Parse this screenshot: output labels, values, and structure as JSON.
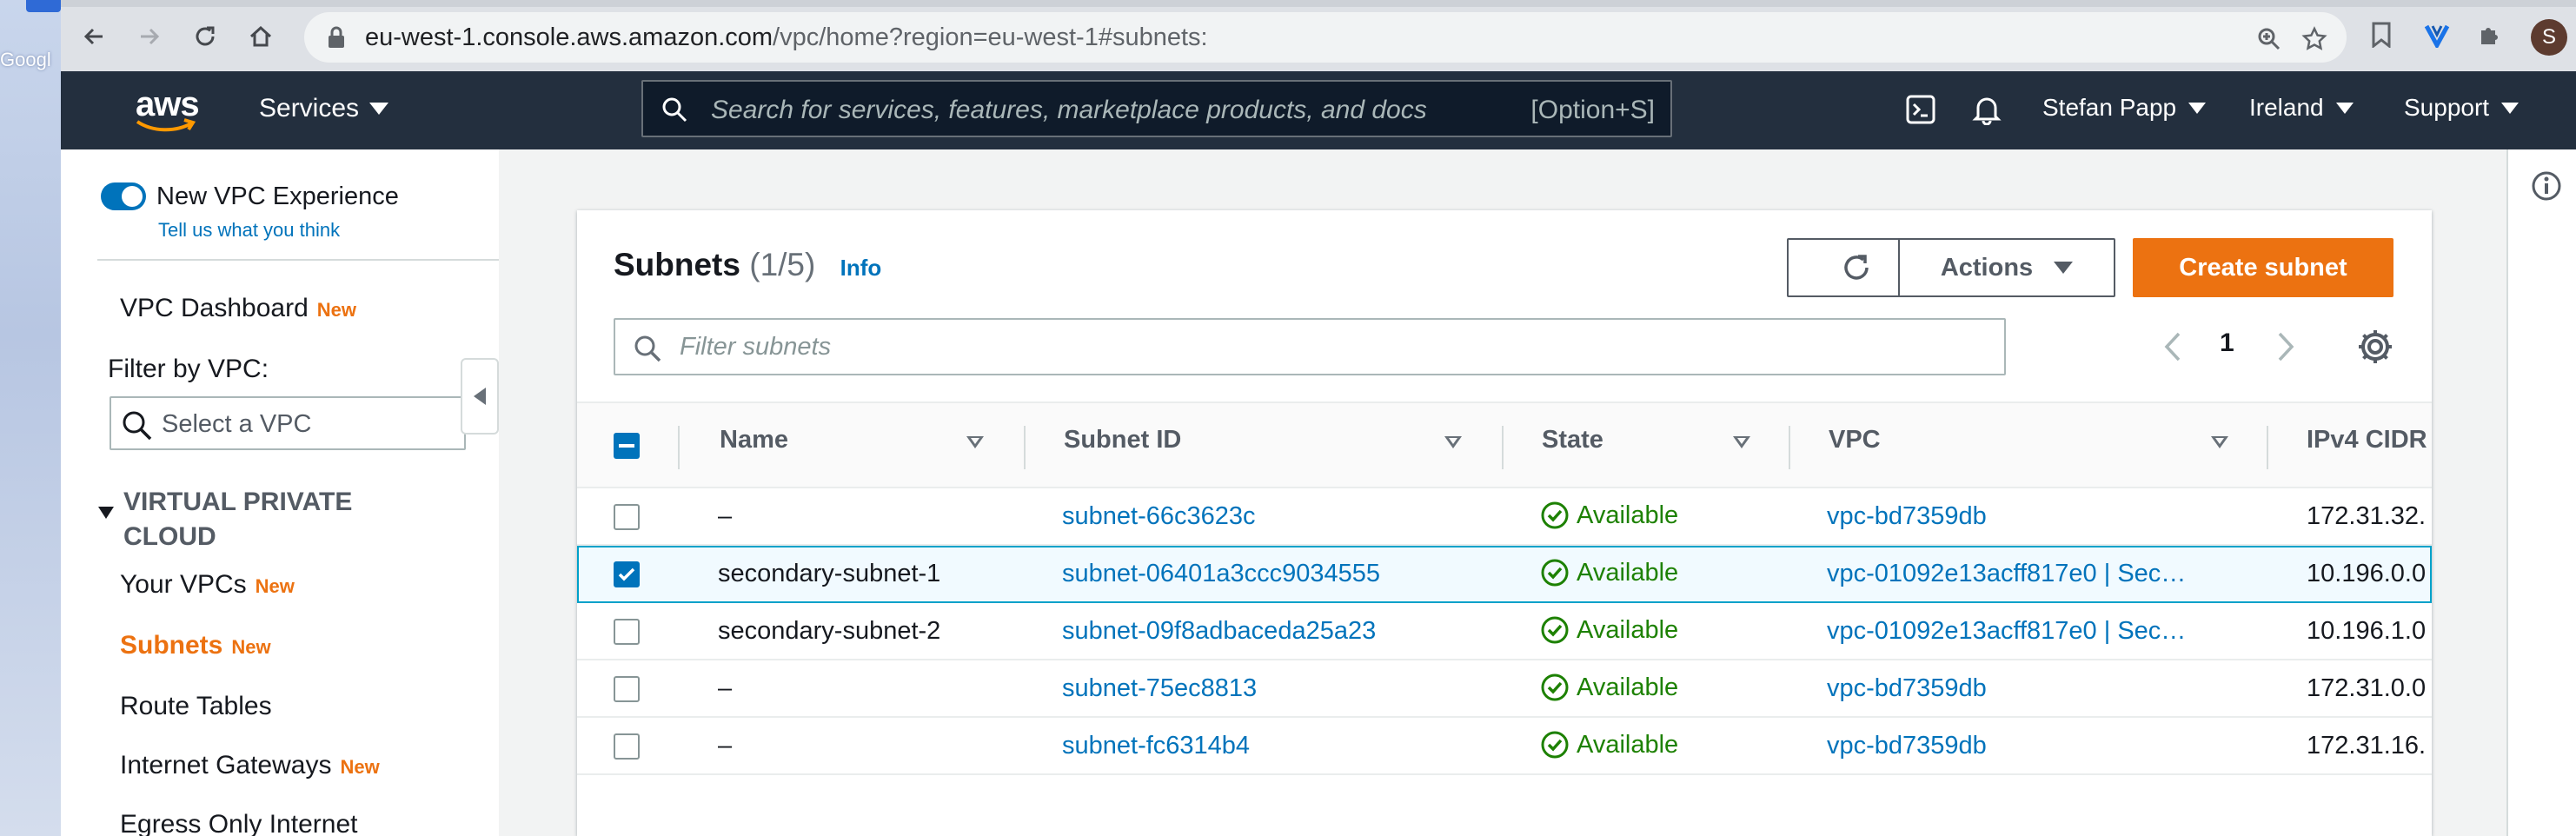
{
  "browser": {
    "url_host": "eu-west-1.console.aws.amazon.com",
    "url_path": "/vpc/home?region=eu-west-1#subnets:",
    "avatar_letter": "S"
  },
  "desktop": {
    "label": "Googl"
  },
  "aws_nav": {
    "logo_text": "aws",
    "services_label": "Services",
    "search_placeholder": "Search for services, features, marketplace products, and docs",
    "search_shortcut": "[Option+S]",
    "user": "Stefan Papp",
    "region": "Ireland",
    "support": "Support"
  },
  "sidebar": {
    "toggle_label": "New VPC Experience",
    "feedback_link": "Tell us what you think",
    "dashboard": "VPC Dashboard",
    "new_badge": "New",
    "filter_label": "Filter by VPC:",
    "vpc_placeholder": "Select a VPC",
    "section_line1": "VIRTUAL PRIVATE",
    "section_line2": "CLOUD",
    "items": [
      {
        "label": "Your VPCs",
        "new": "New"
      },
      {
        "label": "Subnets",
        "new": "New"
      },
      {
        "label": "Route Tables",
        "new": ""
      },
      {
        "label": "Internet Gateways",
        "new": "New"
      },
      {
        "label": "Egress Only Internet",
        "new": ""
      }
    ]
  },
  "panel": {
    "title": "Subnets",
    "count": "(1/5)",
    "info": "Info",
    "actions_label": "Actions",
    "create_label": "Create subnet",
    "filter_placeholder": "Filter subnets",
    "page": "1"
  },
  "table": {
    "columns": [
      "Name",
      "Subnet ID",
      "State",
      "VPC",
      "IPv4 CIDR"
    ],
    "rows": [
      {
        "name": "–",
        "subnet_id": "subnet-66c3623c",
        "state": "Available",
        "vpc": "vpc-bd7359db",
        "cidr": "172.31.32.",
        "selected": false
      },
      {
        "name": "secondary-subnet-1",
        "subnet_id": "subnet-06401a3ccc9034555",
        "state": "Available",
        "vpc": "vpc-01092e13acff817e0 | Sec…",
        "cidr": "10.196.0.0",
        "selected": true
      },
      {
        "name": "secondary-subnet-2",
        "subnet_id": "subnet-09f8adbaceda25a23",
        "state": "Available",
        "vpc": "vpc-01092e13acff817e0 | Sec…",
        "cidr": "10.196.1.0",
        "selected": false
      },
      {
        "name": "–",
        "subnet_id": "subnet-75ec8813",
        "state": "Available",
        "vpc": "vpc-bd7359db",
        "cidr": "172.31.0.0",
        "selected": false
      },
      {
        "name": "–",
        "subnet_id": "subnet-fc6314b4",
        "state": "Available",
        "vpc": "vpc-bd7359db",
        "cidr": "172.31.16.",
        "selected": false
      }
    ]
  },
  "colors": {
    "aws_nav_bg": "#232f3e",
    "accent_orange": "#ec7211",
    "link_blue": "#0073bb",
    "available_green": "#1d8102"
  }
}
